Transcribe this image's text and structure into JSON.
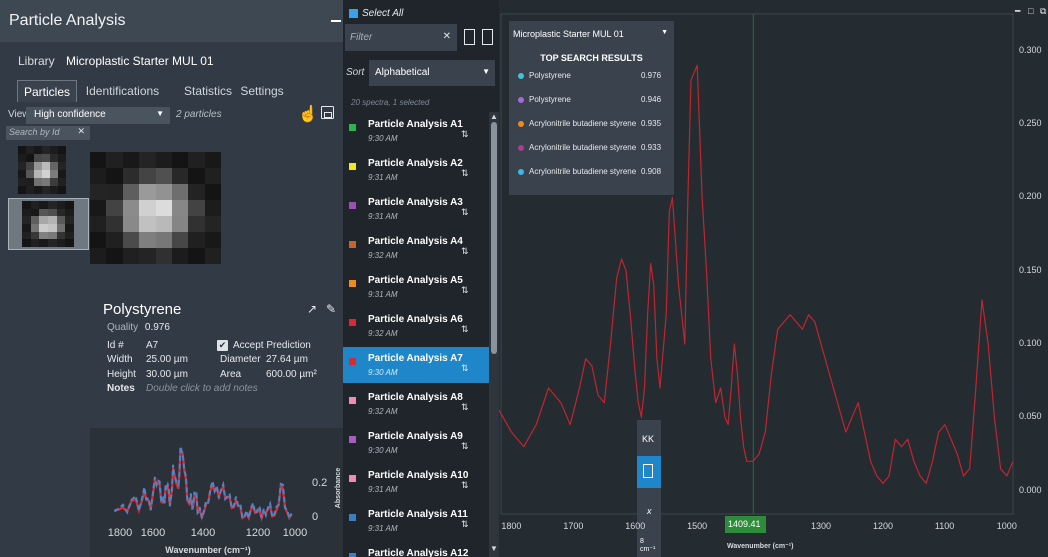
{
  "left": {
    "title": "Particle Analysis",
    "library_label": "Library",
    "library_value": "Microplastic Starter MUL 01",
    "tabs": [
      "Particles",
      "Identifications",
      "Statistics",
      "Settings"
    ],
    "view_label": "View",
    "view_value": "High confidence",
    "particle_count": "2 particles",
    "search_placeholder": "Search by Id",
    "details": {
      "name": "Polystyrene",
      "quality_label": "Quality",
      "quality_value": "0.976",
      "id_label": "Id #",
      "id_value": "A7",
      "accept_label": "Accept Prediction",
      "width_label": "Width",
      "width_value": "25.00 µm",
      "diameter_label": "Diameter",
      "diameter_value": "27.64 µm",
      "height_label": "Height",
      "height_value": "30.00 µm",
      "area_label": "Area",
      "area_value": "600.00 µm²",
      "notes_label": "Notes",
      "notes_placeholder": "Double click to add notes"
    },
    "mini_chart": {
      "xlabel": "Wavenumber (cm⁻¹)",
      "ylabel": "Absorbance",
      "xticks": [
        "1800",
        "1600",
        "1400",
        "1200",
        "1000"
      ],
      "yticks": [
        "0.2",
        "0"
      ]
    }
  },
  "middle": {
    "select_all": "Select All",
    "filter_placeholder": "Filter",
    "sort_label": "Sort",
    "sort_value": "Alphabetical",
    "meta": "20 spectra, 1 selected",
    "items": [
      {
        "name": "Particle Analysis A1",
        "time": "9:30 AM",
        "color": "#2fb34a"
      },
      {
        "name": "Particle Analysis A2",
        "time": "9:31 AM",
        "color": "#f2e521"
      },
      {
        "name": "Particle Analysis A3",
        "time": "9:31 AM",
        "color": "#9b4fb3"
      },
      {
        "name": "Particle Analysis A4",
        "time": "9:32 AM",
        "color": "#c5652a"
      },
      {
        "name": "Particle Analysis A5",
        "time": "9:31 AM",
        "color": "#f08a1c"
      },
      {
        "name": "Particle Analysis A6",
        "time": "9:32 AM",
        "color": "#d62a35"
      },
      {
        "name": "Particle Analysis A7",
        "time": "9:30 AM",
        "color": "#d62a35"
      },
      {
        "name": "Particle Analysis A8",
        "time": "9:32 AM",
        "color": "#f28ab8"
      },
      {
        "name": "Particle Analysis A9",
        "time": "9:30 AM",
        "color": "#a85cc1"
      },
      {
        "name": "Particle Analysis A10",
        "time": "9:31 AM",
        "color": "#f28ab8"
      },
      {
        "name": "Particle Analysis A11",
        "time": "9:31 AM",
        "color": "#3a7fc1"
      },
      {
        "name": "Particle Analysis A12",
        "time": "",
        "color": "#3a7fc1"
      }
    ],
    "active_index": 6
  },
  "right": {
    "library_value": "Microplastic Starter MUL 01",
    "results_title": "TOP SEARCH RESULTS",
    "results": [
      {
        "name": "Polystyrene",
        "score": "0.976",
        "color": "#3fc4d6"
      },
      {
        "name": "Polystyrene",
        "score": "0.946",
        "color": "#a66bdb"
      },
      {
        "name": "Acrylonitrile butadiene styrene",
        "score": "0.935",
        "color": "#f08a1c"
      },
      {
        "name": "Acrylonitrile butadiene styrene",
        "score": "0.933",
        "color": "#b03a8c"
      },
      {
        "name": "Acrylonitrile butadiene styrene",
        "score": "0.908",
        "color": "#3fb4f0"
      }
    ],
    "tools": {
      "kk": "KK",
      "x": "x",
      "resolution": "8 cm⁻¹"
    },
    "cursor_value": "1409.41",
    "xlabel": "Wavenumber (cm⁻¹)"
  },
  "chart_data": [
    {
      "type": "line",
      "xlabel": "Wavenumber (cm⁻¹)",
      "ylabel": "",
      "xlim": [
        1820,
        990
      ],
      "ylim": [
        -0.005,
        0.31
      ],
      "xticks": [
        "1800",
        "1700",
        "1600",
        "1500",
        "1409.41",
        "1300",
        "1200",
        "1100",
        "1000"
      ],
      "yticks": [
        "0.300",
        "0.250",
        "0.200",
        "0.150",
        "0.100",
        "0.050",
        "0.000"
      ],
      "series": [
        {
          "color": "#c0262f",
          "x": [
            1820,
            1800,
            1780,
            1760,
            1740,
            1720,
            1705,
            1690,
            1680,
            1670,
            1660,
            1650,
            1640,
            1630,
            1622,
            1615,
            1608,
            1600,
            1595,
            1590,
            1585,
            1580,
            1575,
            1570,
            1565,
            1560,
            1550,
            1545,
            1540,
            1530,
            1520,
            1515,
            1510,
            1500,
            1492,
            1485,
            1478,
            1470,
            1462,
            1455,
            1450,
            1445,
            1440,
            1435,
            1430,
            1425,
            1420,
            1410,
            1400,
            1390,
            1380,
            1370,
            1360,
            1350,
            1340,
            1330,
            1320,
            1310,
            1300,
            1290,
            1280,
            1270,
            1260,
            1250,
            1240,
            1230,
            1220,
            1210,
            1200,
            1190,
            1180,
            1170,
            1160,
            1150,
            1140,
            1130,
            1120,
            1110,
            1100,
            1090,
            1080,
            1070,
            1060,
            1050,
            1040,
            1030,
            1020,
            1010,
            1000,
            990
          ],
          "y": [
            0.055,
            0.04,
            0.03,
            0.045,
            0.07,
            0.06,
            0.045,
            0.07,
            0.09,
            0.085,
            0.065,
            0.06,
            0.1,
            0.145,
            0.158,
            0.15,
            0.12,
            0.08,
            0.06,
            0.05,
            0.07,
            0.12,
            0.155,
            0.14,
            0.09,
            0.07,
            0.12,
            0.19,
            0.2,
            0.14,
            0.1,
            0.2,
            0.28,
            0.29,
            0.2,
            0.15,
            0.09,
            0.06,
            0.07,
            0.05,
            0.045,
            0.07,
            0.1,
            0.08,
            0.05,
            0.03,
            0.02,
            0.02,
            0.025,
            0.04,
            0.08,
            0.11,
            0.115,
            0.12,
            0.115,
            0.11,
            0.12,
            0.115,
            0.1,
            0.085,
            0.07,
            0.055,
            0.04,
            0.05,
            0.06,
            0.04,
            0.02,
            0.01,
            0.005,
            0.01,
            0.035,
            0.03,
            0.035,
            0.02,
            0.01,
            0.005,
            0.02,
            0.04,
            0.045,
            0.035,
            0.025,
            0.01,
            0.015,
            0.07,
            0.13,
            0.1,
            0.05,
            0.015,
            0.01,
            0.02
          ]
        }
      ]
    }
  ]
}
